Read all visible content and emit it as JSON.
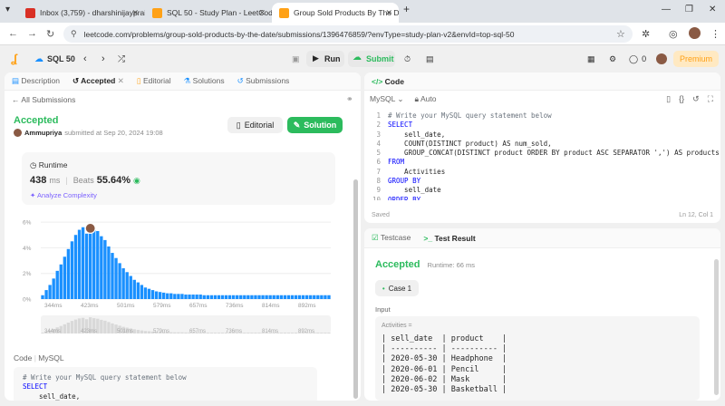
{
  "browser": {
    "tabs": [
      {
        "title": "Inbox (3,759) - dharshinijayprai...",
        "color": "#d93025"
      },
      {
        "title": "SQL 50 - Study Plan - LeetCode",
        "color": "#ffa116"
      },
      {
        "title": "Group Sold Products By The Da...",
        "color": "#ffa116"
      }
    ],
    "url": "leetcode.com/problems/group-sold-products-by-the-date/submissions/1396476859/?envType=study-plan-v2&envId=top-sql-50"
  },
  "header": {
    "plan": "SQL 50",
    "run": "Run",
    "submit": "Submit",
    "fire_count": "0",
    "premium": "Premium"
  },
  "left": {
    "tabs": [
      "Description",
      "Accepted",
      "Editorial",
      "Solutions",
      "Submissions"
    ],
    "back": "All Submissions",
    "status": "Accepted",
    "user": "Ammupriya",
    "submitted": "submitted at Sep 20, 2024 19:08",
    "editorial_btn": "Editorial",
    "solution_btn": "Solution",
    "runtime_label": "Runtime",
    "runtime_value": "438",
    "runtime_unit": "ms",
    "beats_label": "Beats",
    "beats_value": "55.64%",
    "analyze": "Analyze Complexity",
    "code_label": "Code",
    "code_lang": "MySQL",
    "code_lines": [
      "# Write your MySQL query statement below",
      "SELECT",
      "    sell_date,"
    ]
  },
  "chart_data": {
    "type": "bar",
    "yticks": [
      "6%",
      "4%",
      "2%",
      "0%"
    ],
    "ylim": [
      0,
      6.5
    ],
    "xticks": [
      "344ms",
      "423ms",
      "501ms",
      "579ms",
      "657ms",
      "736ms",
      "814ms",
      "892ms"
    ],
    "values": [
      0.3,
      0.7,
      1.1,
      1.6,
      2.2,
      2.7,
      3.3,
      3.9,
      4.5,
      5.0,
      5.4,
      5.6,
      5.1,
      5.8,
      5.5,
      5.3,
      4.9,
      4.6,
      4.1,
      3.6,
      3.2,
      2.8,
      2.4,
      2.1,
      1.8,
      1.5,
      1.3,
      1.1,
      0.9,
      0.8,
      0.7,
      0.6,
      0.55,
      0.5,
      0.45,
      0.45,
      0.4,
      0.4,
      0.4,
      0.35,
      0.35,
      0.35,
      0.35,
      0.35,
      0.3,
      0.3,
      0.3,
      0.3,
      0.3,
      0.3,
      0.3,
      0.3,
      0.3,
      0.3,
      0.3,
      0.3,
      0.3,
      0.3,
      0.3,
      0.3,
      0.3,
      0.3,
      0.3,
      0.3,
      0.3,
      0.3,
      0.3,
      0.3,
      0.3,
      0.3,
      0.3,
      0.3,
      0.3,
      0.3,
      0.3,
      0.3,
      0.3,
      0.3,
      0.3
    ],
    "highlight_index": 13,
    "bar_color": "#1a90ff"
  },
  "editor": {
    "title": "Code",
    "lang": "MySQL",
    "auto": "Auto",
    "lines": [
      "# Write your MySQL query statement below",
      "SELECT",
      "    sell_date,",
      "    COUNT(DISTINCT product) AS num_sold,",
      "    GROUP_CONCAT(DISTINCT product ORDER BY product ASC SEPARATOR ',') AS products",
      "FROM",
      "    Activities",
      "GROUP BY",
      "    sell_date",
      "ORDER BY"
    ],
    "saved": "Saved",
    "position": "Ln 12, Col 1"
  },
  "result": {
    "tab_testcase": "Testcase",
    "tab_result": "Test Result",
    "status": "Accepted",
    "runtime": "Runtime: 66 ms",
    "case": "Case 1",
    "input_label": "Input",
    "table_name": "Activities =",
    "rows": [
      "| sell_date  | product    |",
      "| ---------- | ---------- |",
      "| 2020-05-30 | Headphone  |",
      "| 2020-06-01 | Pencil     |",
      "| 2020-06-02 | Mask       |",
      "| 2020-05-30 | Basketball |"
    ]
  }
}
